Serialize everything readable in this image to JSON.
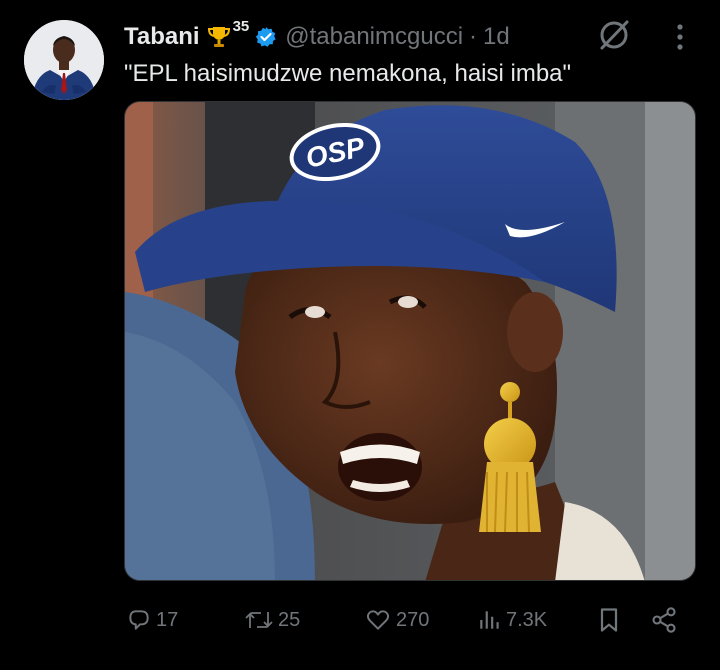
{
  "user": {
    "name": "Tabani",
    "trophy_count": "35",
    "handle": "@tabanimcgucci",
    "separator": "·",
    "time": "1d"
  },
  "tweet": {
    "text": "\"EPL haisimudzwe nemakona, haisi imba\""
  },
  "media": {
    "cap_logo": "OSP"
  },
  "actions": {
    "replies": "17",
    "reposts": "25",
    "likes": "270",
    "views": "7.3K"
  },
  "colors": {
    "background": "#000000",
    "text": "#e7e9ea",
    "muted": "#71767b",
    "verified": "#1d9bf0",
    "trophy": "#f5b700"
  },
  "icons": {
    "verified": "verified-badge-icon",
    "trophy": "trophy-icon",
    "grok": "grok-icon",
    "more": "more-icon",
    "reply": "reply-icon",
    "repost": "repost-icon",
    "like": "heart-icon",
    "views": "views-icon",
    "bookmark": "bookmark-icon",
    "share": "share-icon"
  }
}
